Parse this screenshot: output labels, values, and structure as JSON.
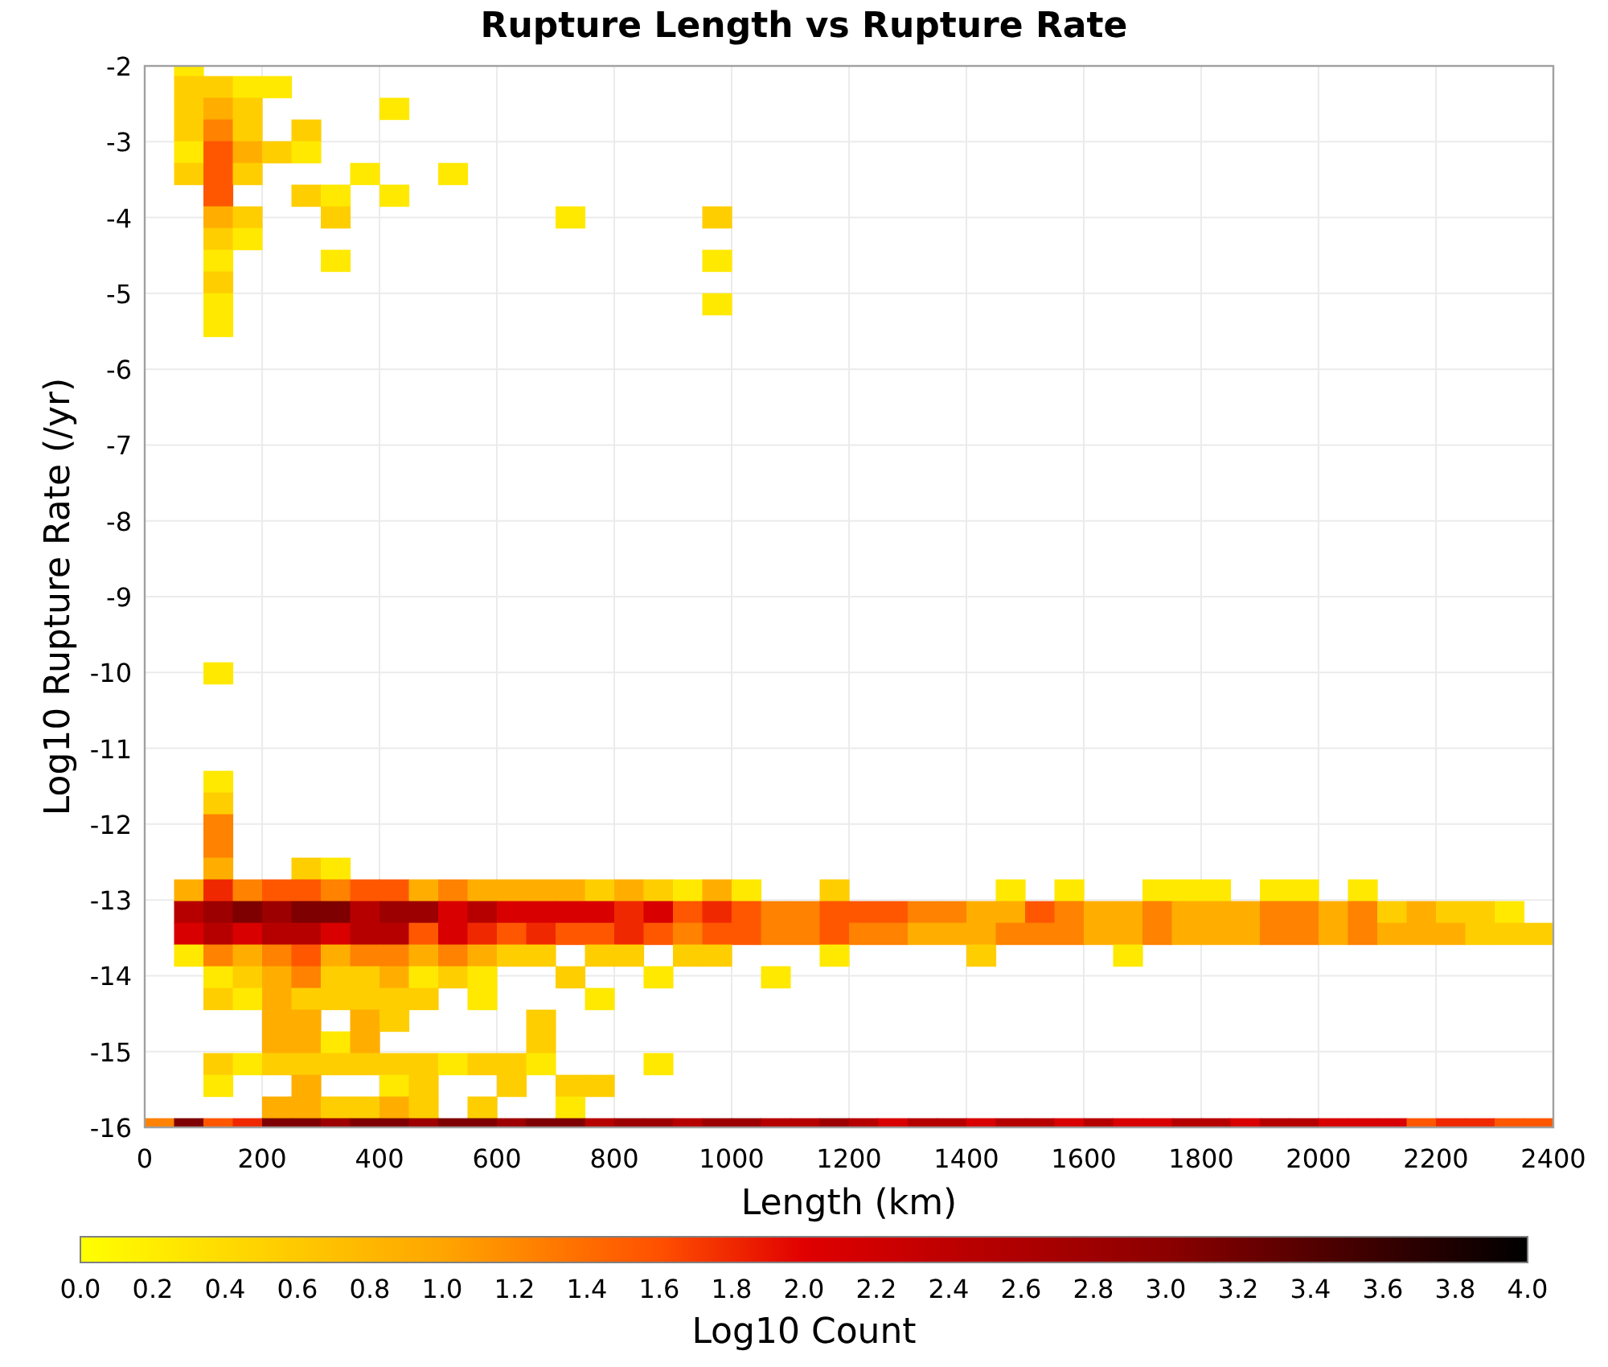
{
  "chart": {
    "title": "Rupture Length vs Rupture Rate",
    "ylabel": "Log10 Rupture Rate (/yr)",
    "xlabel": "Length (km)",
    "yticks": [
      "-2",
      "-3",
      "-4",
      "-5",
      "-6",
      "-7",
      "-8",
      "-9",
      "-10",
      "-11",
      "-12",
      "-13",
      "-14",
      "-15",
      "-16"
    ],
    "xticks": [
      "0",
      "200",
      "400",
      "600",
      "800",
      "1000",
      "1200",
      "1400",
      "1600",
      "1800",
      "2000",
      "2200",
      "2400"
    ]
  },
  "colorbar": {
    "label": "Log10 Count",
    "ticks": [
      "0.0",
      "0.2",
      "0.4",
      "0.6",
      "0.8",
      "1.0",
      "1.2",
      "1.4",
      "1.6",
      "1.8",
      "2.0",
      "2.2",
      "2.4",
      "2.6",
      "2.8",
      "3.0",
      "3.2",
      "3.4",
      "3.6",
      "3.8",
      "4.0"
    ]
  }
}
